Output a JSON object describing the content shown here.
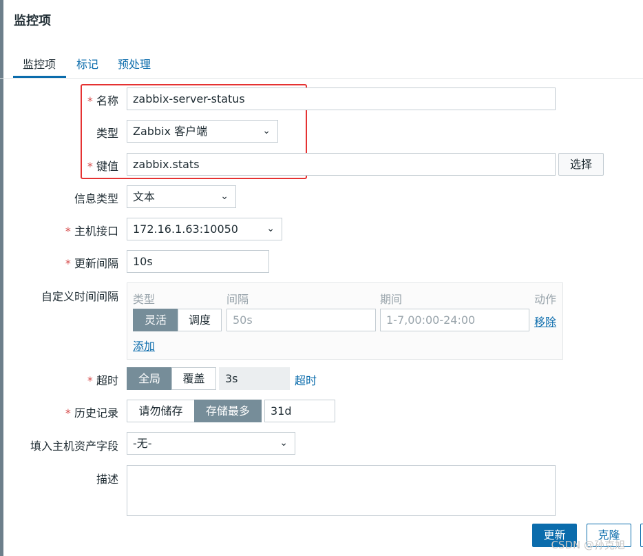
{
  "page": {
    "title": "监控项"
  },
  "tabs": [
    {
      "label": "监控项"
    },
    {
      "label": "标记"
    },
    {
      "label": "预处理"
    }
  ],
  "form": {
    "name": {
      "label": "名称",
      "value": "zabbix-server-status"
    },
    "type": {
      "label": "类型",
      "value": "Zabbix 客户端"
    },
    "key": {
      "label": "键值",
      "value": "zabbix.stats",
      "select_label": "选择"
    },
    "info_type": {
      "label": "信息类型",
      "value": "文本"
    },
    "host_interface": {
      "label": "主机接口",
      "value": "172.16.1.63:10050"
    },
    "update_interval": {
      "label": "更新间隔",
      "value": "10s"
    },
    "custom_intervals": {
      "label": "自定义时间间隔",
      "headers": {
        "type": "类型",
        "interval": "间隔",
        "period": "期间",
        "action": "动作"
      },
      "row": {
        "mode_flexible": "灵活",
        "mode_scheduling": "调度",
        "interval_placeholder": "50s",
        "period_placeholder": "1-7,00:00-24:00",
        "remove": "移除"
      },
      "add": "添加"
    },
    "timeout": {
      "label": "超时",
      "global": "全局",
      "override": "覆盖",
      "value": "3s",
      "link": "超时"
    },
    "history": {
      "label": "历史记录",
      "do_not_store": "请勿储存",
      "store_up_to": "存储最多",
      "value": "31d"
    },
    "inventory": {
      "label": "填入主机资产字段",
      "value": "-无-"
    },
    "description": {
      "label": "描述",
      "value": ""
    }
  },
  "footer": {
    "update": "更新",
    "clone": "克隆"
  },
  "watermark": "CSDN @孙克旭",
  "colors": {
    "primary": "#0b6cac",
    "highlight_border": "#e53232",
    "required": "#d64e4e",
    "segment_on": "#768d99"
  }
}
